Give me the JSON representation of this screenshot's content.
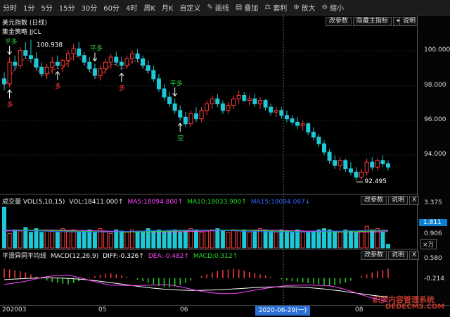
{
  "toolbar": {
    "items": [
      {
        "label": "分时",
        "icon": ""
      },
      {
        "label": "1分",
        "icon": ""
      },
      {
        "label": "5分",
        "icon": ""
      },
      {
        "label": "15分",
        "icon": ""
      },
      {
        "label": "30分",
        "icon": ""
      },
      {
        "label": "60分",
        "icon": ""
      },
      {
        "label": "4时",
        "icon": ""
      },
      {
        "label": "周K",
        "icon": ""
      },
      {
        "label": "月K",
        "icon": ""
      },
      {
        "label": "自定义",
        "icon": ""
      },
      {
        "label": "画线",
        "icon": "pencil-icon"
      },
      {
        "label": "叠加",
        "icon": "overlay-icon"
      },
      {
        "label": "套利",
        "icon": "arbitrage-icon"
      },
      {
        "label": "放大",
        "icon": "zoom-in-icon"
      },
      {
        "label": "缩小",
        "icon": "zoom-out-icon"
      }
    ]
  },
  "main": {
    "title": "美元指数 (日线)",
    "strategy": "集金策略 JJCL",
    "buttons": [
      "改参数",
      "隐藏主指标"
    ],
    "help": "说明",
    "nav_left": "⬅",
    "nav_right": "➡",
    "high_label": "100.938",
    "low_label": "92.495",
    "y_ticks": [
      "100.000",
      "98.000",
      "96.000",
      "94.000"
    ],
    "signals": [
      {
        "text": "平多",
        "color": "#2ecc40"
      },
      {
        "text": "平多",
        "color": "#2ecc40"
      },
      {
        "text": "平多",
        "color": "#2ecc40"
      },
      {
        "text": "多",
        "color": "#ff3b3b"
      },
      {
        "text": "多",
        "color": "#ff3b3b"
      },
      {
        "text": "多",
        "color": "#ff3b3b"
      },
      {
        "text": "空",
        "color": "#2ecc40"
      }
    ]
  },
  "volume": {
    "title": "成交量 VOL(5,10,15)",
    "vol": "VOL:18411.000↑",
    "ma5": "MA5:18094.800↑",
    "ma10": "MA10:18033.900↑",
    "ma15": "MA15:18094.067↓",
    "ma5_color": "#ff44ff",
    "ma10_color": "#22dd22",
    "ma15_color": "#3366ff",
    "buttons": [
      "改参数",
      "说明"
    ],
    "close": "X",
    "y_ticks": [
      "3.375",
      "1.811",
      "0.906"
    ],
    "unit": "×万"
  },
  "macd": {
    "title": "平滑异同平均线",
    "params": "MACD(12,26,9)",
    "diff": "DIFF:-0.326↑",
    "dea": "DEA:-0.482↑",
    "macd": "MACD:0.312↑",
    "diff_color": "#ffffff",
    "dea_color": "#ff44ff",
    "macd_color": "#22dd22",
    "buttons": [
      "改参数",
      "说明"
    ],
    "close": "X",
    "y_ticks": [
      "0.580",
      "-0.214"
    ]
  },
  "dates": {
    "labels": [
      "202003",
      "05",
      "06",
      "08"
    ],
    "current": "2020-06-29(一)"
  },
  "watermark": {
    "line1": "织梦内容管理系统",
    "line2": "DEDECMS.COM"
  },
  "chart_data": {
    "type": "candlestick",
    "y_range": [
      92.0,
      101.3
    ],
    "candles": [
      {
        "o": 98.6,
        "h": 99.0,
        "l": 97.9,
        "c": 98.3
      },
      {
        "o": 98.3,
        "h": 99.9,
        "l": 98.1,
        "c": 99.6
      },
      {
        "o": 99.6,
        "h": 100.0,
        "l": 99.1,
        "c": 99.4
      },
      {
        "o": 99.4,
        "h": 100.5,
        "l": 99.2,
        "c": 100.3
      },
      {
        "o": 100.3,
        "h": 100.8,
        "l": 99.8,
        "c": 100.0
      },
      {
        "o": 100.0,
        "h": 100.94,
        "l": 99.6,
        "c": 99.8
      },
      {
        "o": 99.8,
        "h": 100.2,
        "l": 99.1,
        "c": 99.3
      },
      {
        "o": 99.3,
        "h": 99.6,
        "l": 98.7,
        "c": 98.9
      },
      {
        "o": 98.9,
        "h": 99.5,
        "l": 98.6,
        "c": 99.3
      },
      {
        "o": 99.3,
        "h": 99.9,
        "l": 98.9,
        "c": 99.6
      },
      {
        "o": 99.6,
        "h": 100.0,
        "l": 99.2,
        "c": 99.4
      },
      {
        "o": 99.4,
        "h": 99.8,
        "l": 99.0,
        "c": 99.7
      },
      {
        "o": 99.7,
        "h": 100.3,
        "l": 99.3,
        "c": 100.1
      },
      {
        "o": 100.1,
        "h": 100.7,
        "l": 99.7,
        "c": 100.4
      },
      {
        "o": 100.4,
        "h": 100.8,
        "l": 99.9,
        "c": 100.0
      },
      {
        "o": 100.0,
        "h": 100.2,
        "l": 99.4,
        "c": 99.6
      },
      {
        "o": 99.6,
        "h": 99.9,
        "l": 99.0,
        "c": 99.2
      },
      {
        "o": 99.2,
        "h": 99.5,
        "l": 98.6,
        "c": 98.8
      },
      {
        "o": 98.8,
        "h": 99.4,
        "l": 98.5,
        "c": 99.2
      },
      {
        "o": 99.2,
        "h": 99.8,
        "l": 98.9,
        "c": 99.6
      },
      {
        "o": 99.6,
        "h": 100.1,
        "l": 99.2,
        "c": 99.9
      },
      {
        "o": 99.9,
        "h": 100.2,
        "l": 99.4,
        "c": 99.6
      },
      {
        "o": 99.6,
        "h": 99.9,
        "l": 99.1,
        "c": 99.4
      },
      {
        "o": 99.4,
        "h": 100.0,
        "l": 99.2,
        "c": 99.8
      },
      {
        "o": 99.8,
        "h": 100.3,
        "l": 99.5,
        "c": 100.1
      },
      {
        "o": 100.1,
        "h": 100.4,
        "l": 99.6,
        "c": 99.8
      },
      {
        "o": 99.8,
        "h": 100.0,
        "l": 99.2,
        "c": 99.4
      },
      {
        "o": 99.4,
        "h": 99.7,
        "l": 98.9,
        "c": 99.1
      },
      {
        "o": 99.1,
        "h": 99.4,
        "l": 98.4,
        "c": 98.6
      },
      {
        "o": 98.6,
        "h": 98.9,
        "l": 97.8,
        "c": 98.0
      },
      {
        "o": 98.0,
        "h": 98.3,
        "l": 97.3,
        "c": 97.5
      },
      {
        "o": 97.5,
        "h": 97.8,
        "l": 96.9,
        "c": 97.1
      },
      {
        "o": 97.1,
        "h": 97.4,
        "l": 96.5,
        "c": 96.7
      },
      {
        "o": 96.7,
        "h": 97.0,
        "l": 96.1,
        "c": 96.3
      },
      {
        "o": 96.3,
        "h": 96.6,
        "l": 95.7,
        "c": 95.9
      },
      {
        "o": 95.9,
        "h": 96.7,
        "l": 95.7,
        "c": 96.5
      },
      {
        "o": 96.5,
        "h": 96.9,
        "l": 96.0,
        "c": 96.2
      },
      {
        "o": 96.2,
        "h": 96.9,
        "l": 96.0,
        "c": 96.7
      },
      {
        "o": 96.7,
        "h": 97.3,
        "l": 96.4,
        "c": 97.1
      },
      {
        "o": 97.1,
        "h": 97.6,
        "l": 96.8,
        "c": 97.4
      },
      {
        "o": 97.4,
        "h": 97.7,
        "l": 96.9,
        "c": 97.1
      },
      {
        "o": 97.1,
        "h": 97.3,
        "l": 96.5,
        "c": 96.7
      },
      {
        "o": 96.7,
        "h": 97.2,
        "l": 96.5,
        "c": 97.0
      },
      {
        "o": 97.0,
        "h": 97.6,
        "l": 96.8,
        "c": 97.4
      },
      {
        "o": 97.4,
        "h": 97.9,
        "l": 97.1,
        "c": 97.6
      },
      {
        "o": 97.6,
        "h": 97.8,
        "l": 97.2,
        "c": 97.3
      },
      {
        "o": 97.3,
        "h": 97.6,
        "l": 97.0,
        "c": 97.4
      },
      {
        "o": 97.4,
        "h": 97.7,
        "l": 96.9,
        "c": 97.1
      },
      {
        "o": 97.1,
        "h": 97.5,
        "l": 96.8,
        "c": 97.3
      },
      {
        "o": 97.3,
        "h": 97.4,
        "l": 96.7,
        "c": 96.9
      },
      {
        "o": 96.9,
        "h": 97.1,
        "l": 96.4,
        "c": 96.6
      },
      {
        "o": 96.6,
        "h": 96.9,
        "l": 96.3,
        "c": 96.7
      },
      {
        "o": 96.7,
        "h": 96.9,
        "l": 96.2,
        "c": 96.4
      },
      {
        "o": 96.4,
        "h": 96.7,
        "l": 96.0,
        "c": 96.2
      },
      {
        "o": 96.2,
        "h": 96.4,
        "l": 95.8,
        "c": 96.0
      },
      {
        "o": 96.0,
        "h": 96.3,
        "l": 95.6,
        "c": 95.8
      },
      {
        "o": 95.8,
        "h": 96.1,
        "l": 95.5,
        "c": 95.9
      },
      {
        "o": 95.9,
        "h": 96.0,
        "l": 95.2,
        "c": 95.4
      },
      {
        "o": 95.4,
        "h": 95.7,
        "l": 94.9,
        "c": 95.1
      },
      {
        "o": 95.1,
        "h": 95.3,
        "l": 94.5,
        "c": 94.7
      },
      {
        "o": 94.7,
        "h": 94.9,
        "l": 94.0,
        "c": 94.2
      },
      {
        "o": 94.2,
        "h": 94.4,
        "l": 93.5,
        "c": 93.7
      },
      {
        "o": 93.7,
        "h": 94.0,
        "l": 93.2,
        "c": 93.4
      },
      {
        "o": 93.4,
        "h": 93.9,
        "l": 93.1,
        "c": 93.7
      },
      {
        "o": 93.7,
        "h": 93.8,
        "l": 93.0,
        "c": 93.2
      },
      {
        "o": 93.2,
        "h": 93.6,
        "l": 92.8,
        "c": 93.0
      },
      {
        "o": 93.0,
        "h": 93.3,
        "l": 92.5,
        "c": 92.7
      },
      {
        "o": 92.7,
        "h": 93.2,
        "l": 92.5,
        "c": 93.0
      },
      {
        "o": 93.0,
        "h": 93.8,
        "l": 92.8,
        "c": 93.6
      },
      {
        "o": 93.6,
        "h": 93.9,
        "l": 93.1,
        "c": 93.3
      },
      {
        "o": 93.3,
        "h": 93.8,
        "l": 93.1,
        "c": 93.7
      },
      {
        "o": 93.7,
        "h": 94.0,
        "l": 93.3,
        "c": 93.5
      },
      {
        "o": 93.5,
        "h": 93.7,
        "l": 93.1,
        "c": 93.3
      }
    ],
    "volume": [
      3.375,
      1.2,
      1.5,
      1.4,
      1.7,
      1.3,
      1.6,
      1.3,
      1.5,
      1.4,
      1.3,
      1.6,
      1.4,
      1.5,
      1.3,
      1.4,
      1.5,
      1.3,
      1.6,
      1.4,
      1.2,
      1.5,
      1.4,
      1.3,
      1.5,
      1.4,
      1.3,
      1.6,
      1.4,
      1.5,
      1.3,
      1.4,
      1.5,
      1.3,
      1.4,
      1.6,
      1.5,
      1.3,
      1.4,
      1.5,
      1.6,
      1.4,
      1.3,
      1.5,
      1.4,
      1.5,
      1.3,
      1.4,
      1.6,
      1.5,
      1.4,
      1.3,
      1.5,
      1.4,
      1.3,
      1.5,
      1.4,
      1.3,
      1.4,
      1.5,
      1.6,
      1.5,
      1.4,
      1.3,
      1.5,
      1.4,
      1.3,
      1.4,
      1.8,
      1.5,
      1.6,
      1.3,
      0.3
    ],
    "macd_hist": [
      0.3,
      0.28,
      0.25,
      0.22,
      0.18,
      0.12,
      0.05,
      -0.02,
      -0.08,
      -0.12,
      -0.15,
      -0.18,
      -0.2,
      -0.16,
      -0.1,
      -0.05,
      0.02,
      0.06,
      0.1,
      0.14,
      0.16,
      0.12,
      0.08,
      0.04,
      0.0,
      -0.05,
      -0.1,
      -0.15,
      -0.2,
      -0.25,
      -0.28,
      -0.3,
      -0.26,
      -0.22,
      -0.15,
      -0.08,
      0.0,
      0.06,
      0.12,
      0.18,
      0.22,
      0.26,
      0.28,
      0.3,
      0.28,
      0.24,
      0.2,
      0.16,
      0.12,
      0.08,
      0.04,
      0.0,
      -0.04,
      -0.08,
      -0.1,
      -0.12,
      -0.14,
      -0.16,
      -0.18,
      -0.2,
      -0.22,
      -0.24,
      -0.22,
      -0.18,
      -0.14,
      -0.08,
      0.0,
      0.06,
      0.12,
      0.18,
      0.22,
      0.26,
      0.3
    ],
    "macd_range": [
      -0.75,
      0.65
    ]
  }
}
